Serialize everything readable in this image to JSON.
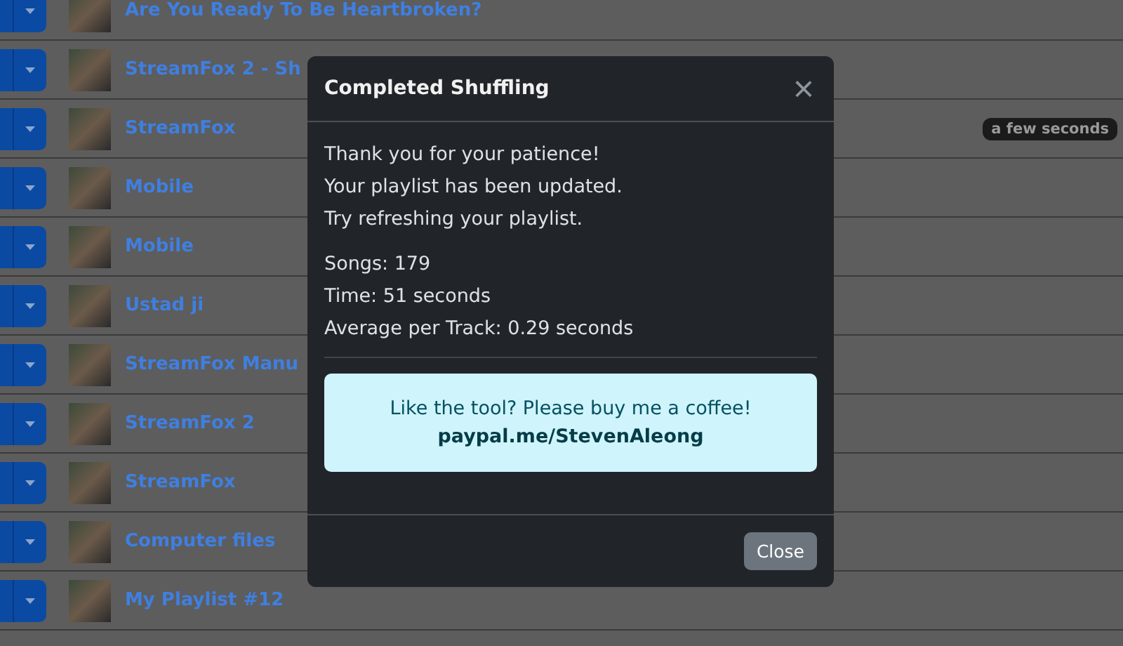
{
  "playlists": [
    {
      "title": "Are You Ready To Be Heartbroken?"
    },
    {
      "title": "StreamFox 2 - Sh"
    },
    {
      "title": "StreamFox",
      "badge": "a few seconds"
    },
    {
      "title": "Mobile"
    },
    {
      "title": "Mobile"
    },
    {
      "title": "Ustad ji"
    },
    {
      "title": "StreamFox Manu"
    },
    {
      "title": "StreamFox 2"
    },
    {
      "title": "StreamFox"
    },
    {
      "title": "Computer files"
    },
    {
      "title": "My Playlist #12"
    }
  ],
  "modal": {
    "title": "Completed Shuffling",
    "close_icon": "×",
    "messages": [
      "Thank you for your patience!",
      "Your playlist has been updated.",
      "Try refreshing your playlist."
    ],
    "stats": [
      "Songs: 179",
      "Time: 51 seconds",
      "Average per Track: 0.29 seconds"
    ],
    "alert": {
      "text": "Like the tool? Please buy me a coffee!",
      "link": "paypal.me/StevenAleong"
    },
    "close_button": "Close"
  }
}
